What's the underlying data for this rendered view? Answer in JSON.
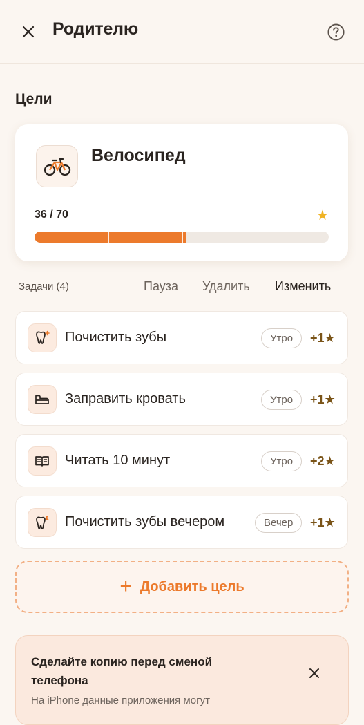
{
  "header": {
    "title": "Родителю",
    "close_icon": "close-icon",
    "help_icon": "question-circle-icon"
  },
  "goals_section": {
    "title": "Цели"
  },
  "goal": {
    "name": "Велосипед",
    "icon": "bicycle-icon",
    "progress_text": "36 / 70",
    "progress_current": 36,
    "progress_target": 70,
    "star_icon": "star-icon"
  },
  "tasks_bar": {
    "count_label": "Задачи (4)",
    "pause_label": "Пауза",
    "delete_label": "Удалить",
    "edit_label": "Изменить"
  },
  "tasks": [
    {
      "title": "Почистить зубы",
      "time": "Утро",
      "reward": "+1★",
      "icon": "tooth-sparkle-icon"
    },
    {
      "title": "Заправить кровать",
      "time": "Утро",
      "reward": "+1★",
      "icon": "bed-icon"
    },
    {
      "title": "Читать 10 минут",
      "time": "Утро",
      "reward": "+2★",
      "icon": "book-icon"
    },
    {
      "title": "Почистить зубы вечером",
      "time": "Вечер",
      "reward": "+1★",
      "icon": "tooth-moon-icon"
    }
  ],
  "add_goal": {
    "label": "Добавить цель",
    "icon": "plus-icon"
  },
  "backup_notice": {
    "title": "Сделайте копию перед сменой телефона",
    "text": "На iPhone данные приложения могут",
    "close_icon": "close-icon"
  },
  "colors": {
    "accent": "#ec7a2c",
    "star": "#f0b324",
    "reward_text": "#7a5418",
    "background": "#fbf6f1"
  }
}
